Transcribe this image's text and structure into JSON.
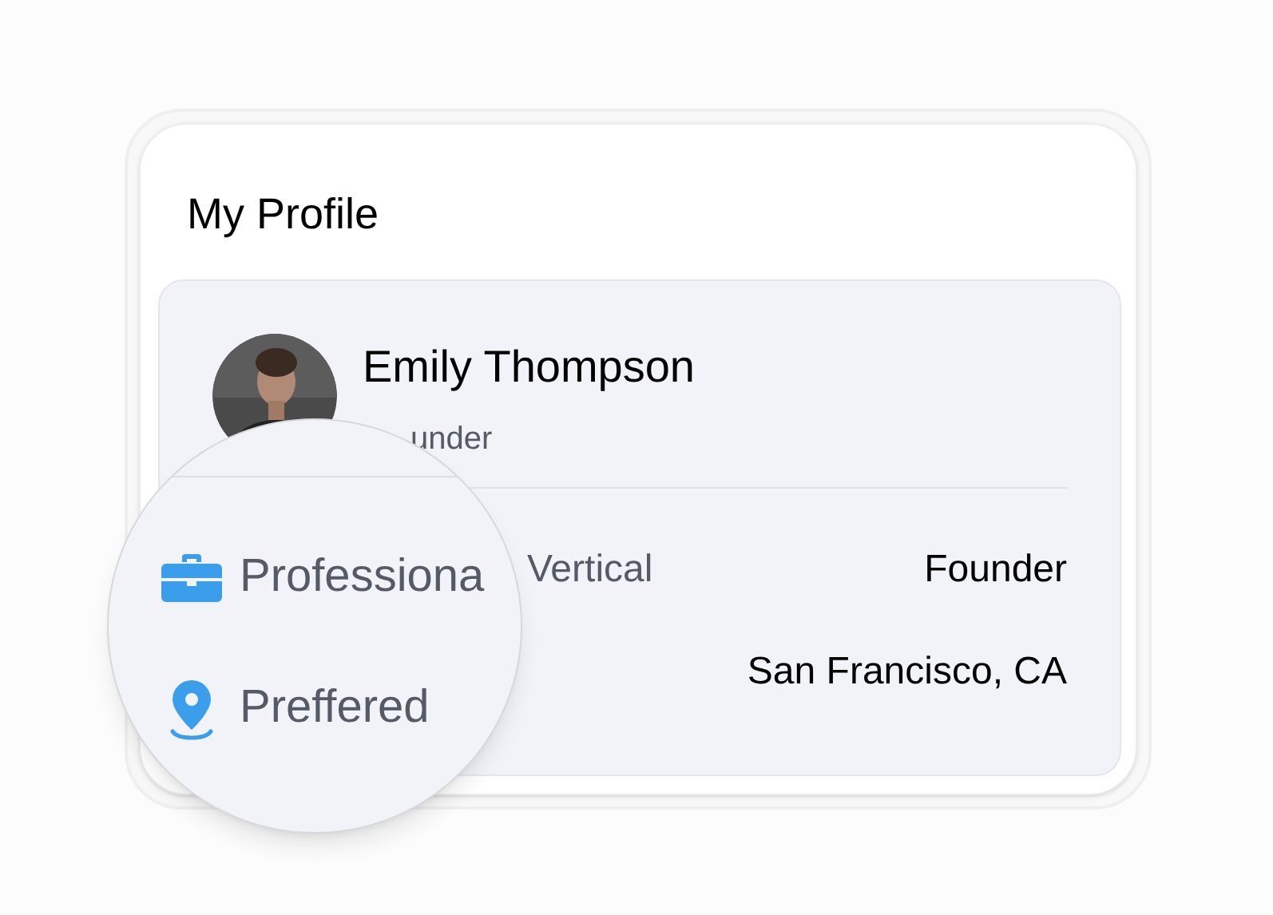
{
  "title": "My Profile",
  "profile": {
    "name": "Emily Thompson",
    "role": "under"
  },
  "fields": [
    {
      "kind": "briefcase",
      "label_magnified": "Professiona",
      "label_behind": "Vertical",
      "value": "Founder"
    },
    {
      "kind": "pin",
      "label_magnified": "Preffered",
      "value": "San Francisco, CA"
    }
  ]
}
